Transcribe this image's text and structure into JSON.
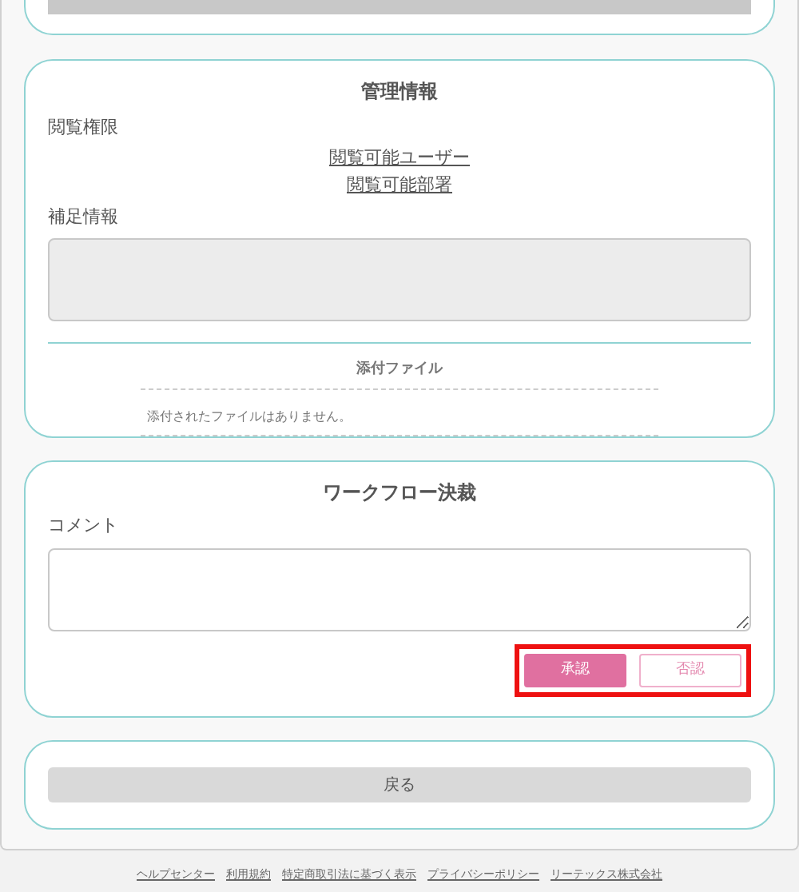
{
  "management": {
    "title": "管理情報",
    "access_label": "閲覧権限",
    "access_links": [
      "閲覧可能ユーザー",
      "閲覧可能部署"
    ],
    "notes_label": "補足情報",
    "attachments": {
      "title": "添付ファイル",
      "empty_message": "添付されたファイルはありません。"
    }
  },
  "workflow": {
    "title": "ワークフロー決裁",
    "comment_label": "コメント",
    "actions_highlighted": true,
    "actions": [
      {
        "label": "承認",
        "kind": "primary"
      },
      {
        "label": "否認",
        "kind": "secondary"
      }
    ]
  },
  "back_button": "戻る",
  "footer_links": [
    "ヘルプセンター",
    "利用規約",
    "特定商取引法に基づく表示",
    "プライバシーポリシー",
    "リーテックス株式会社"
  ]
}
